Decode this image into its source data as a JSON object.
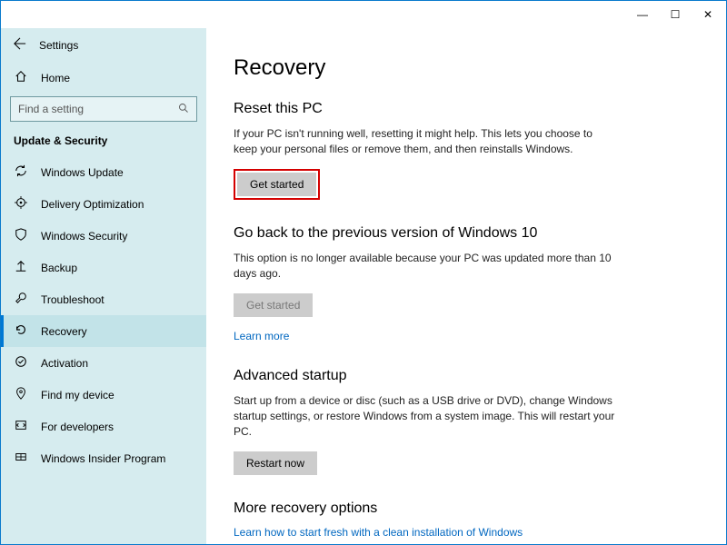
{
  "app_title": "Settings",
  "titlebar": {
    "minimize": "—",
    "maximize": "☐",
    "close": "✕"
  },
  "sidebar": {
    "home_label": "Home",
    "search_placeholder": "Find a setting",
    "section_title": "Update & Security",
    "items": [
      {
        "label": "Windows Update"
      },
      {
        "label": "Delivery Optimization"
      },
      {
        "label": "Windows Security"
      },
      {
        "label": "Backup"
      },
      {
        "label": "Troubleshoot"
      },
      {
        "label": "Recovery"
      },
      {
        "label": "Activation"
      },
      {
        "label": "Find my device"
      },
      {
        "label": "For developers"
      },
      {
        "label": "Windows Insider Program"
      }
    ]
  },
  "main": {
    "page_title": "Recovery",
    "reset": {
      "heading": "Reset this PC",
      "body": "If your PC isn't running well, resetting it might help. This lets you choose to keep your personal files or remove them, and then reinstalls Windows.",
      "button": "Get started"
    },
    "goback": {
      "heading": "Go back to the previous version of Windows 10",
      "body": "This option is no longer available because your PC was updated more than 10 days ago.",
      "button": "Get started",
      "learn_more": "Learn more"
    },
    "advanced": {
      "heading": "Advanced startup",
      "body": "Start up from a device or disc (such as a USB drive or DVD), change Windows startup settings, or restore Windows from a system image. This will restart your PC.",
      "button": "Restart now"
    },
    "more": {
      "heading": "More recovery options",
      "link": "Learn how to start fresh with a clean installation of Windows"
    }
  }
}
